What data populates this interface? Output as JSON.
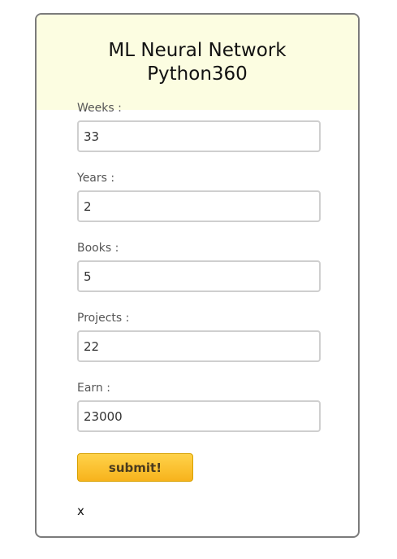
{
  "header": {
    "title_line1": "ML Neural Network",
    "title_line2": "Python360",
    "background_color": "#fcfde1"
  },
  "form": {
    "fields": [
      {
        "label": "Weeks :",
        "value": "33"
      },
      {
        "label": "Years :",
        "value": "2"
      },
      {
        "label": "Books :",
        "value": "5"
      },
      {
        "label": "Projects :",
        "value": "22"
      },
      {
        "label": "Earn :",
        "value": "23000"
      }
    ],
    "submit_label": "submit!",
    "button_color": "#f7b31c"
  },
  "result": {
    "text": "x"
  }
}
